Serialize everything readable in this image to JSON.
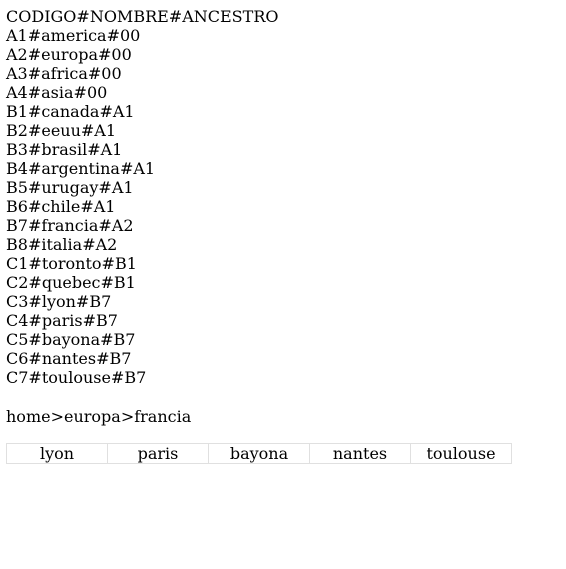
{
  "lines": [
    "CODIGO#NOMBRE#ANCESTRO",
    "A1#america#00",
    "A2#europa#00",
    "A3#africa#00",
    "A4#asia#00",
    "B1#canada#A1",
    "B2#eeuu#A1",
    "B3#brasil#A1",
    "B4#argentina#A1",
    "B5#urugay#A1",
    "B6#chile#A1",
    "B7#francia#A2",
    "B8#italia#A2",
    "C1#toronto#B1",
    "C2#quebec#B1",
    "C3#lyon#B7",
    "C4#paris#B7",
    "C5#bayona#B7",
    "C6#nantes#B7",
    "C7#toulouse#B7"
  ],
  "breadcrumb": {
    "items": [
      "home",
      "europa",
      "francia"
    ],
    "separator": ">"
  },
  "children": [
    "lyon",
    "paris",
    "bayona",
    "nantes",
    "toulouse"
  ]
}
